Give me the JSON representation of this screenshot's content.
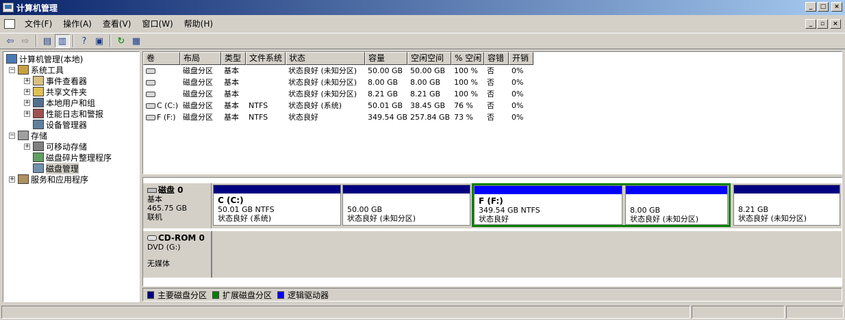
{
  "window": {
    "title": "计算机管理",
    "buttons": [
      "_",
      "□",
      "×"
    ]
  },
  "menubar": {
    "items": [
      "文件(F)",
      "操作(A)",
      "查看(V)",
      "窗口(W)",
      "帮助(H)"
    ],
    "mdi_buttons": [
      "_",
      "▫",
      "×"
    ]
  },
  "toolbar": {
    "icons": [
      "back-arrow-icon",
      "forward-arrow-icon",
      "up-folder-icon",
      "show-tree-icon",
      "help-icon",
      "console-icon",
      "refresh-icon",
      "properties-icon"
    ]
  },
  "tree": {
    "items": [
      {
        "label": "计算机管理(本地)",
        "level": 0,
        "expander": "",
        "icon": "computer-icon"
      },
      {
        "label": "系统工具",
        "level": 1,
        "expander": "−",
        "icon": "tools-icon"
      },
      {
        "label": "事件查看器",
        "level": 2,
        "expander": "+",
        "icon": "event-viewer-icon"
      },
      {
        "label": "共享文件夹",
        "level": 2,
        "expander": "+",
        "icon": "shared-folder-icon"
      },
      {
        "label": "本地用户和组",
        "level": 2,
        "expander": "+",
        "icon": "users-icon"
      },
      {
        "label": "性能日志和警报",
        "level": 2,
        "expander": "+",
        "icon": "performance-icon"
      },
      {
        "label": "设备管理器",
        "level": 2,
        "expander": "",
        "icon": "device-manager-icon"
      },
      {
        "label": "存储",
        "level": 1,
        "expander": "−",
        "icon": "storage-icon"
      },
      {
        "label": "可移动存储",
        "level": 2,
        "expander": "+",
        "icon": "removable-storage-icon"
      },
      {
        "label": "磁盘碎片整理程序",
        "level": 2,
        "expander": "",
        "icon": "defrag-icon"
      },
      {
        "label": "磁盘管理",
        "level": 2,
        "expander": "",
        "icon": "disk-management-icon",
        "selected": true
      },
      {
        "label": "服务和应用程序",
        "level": 1,
        "expander": "+",
        "icon": "services-icon"
      }
    ]
  },
  "volume_list": {
    "columns": [
      "卷",
      "布局",
      "类型",
      "文件系统",
      "状态",
      "容量",
      "空闲空间",
      "% 空闲",
      "容错",
      "开销"
    ],
    "rows": [
      [
        "",
        "磁盘分区",
        "基本",
        "",
        "状态良好 (未知分区)",
        "50.00 GB",
        "50.00 GB",
        "100 %",
        "否",
        "0%"
      ],
      [
        "",
        "磁盘分区",
        "基本",
        "",
        "状态良好 (未知分区)",
        "8.00 GB",
        "8.00 GB",
        "100 %",
        "否",
        "0%"
      ],
      [
        "",
        "磁盘分区",
        "基本",
        "",
        "状态良好 (未知分区)",
        "8.21 GB",
        "8.21 GB",
        "100 %",
        "否",
        "0%"
      ],
      [
        "C (C:)",
        "磁盘分区",
        "基本",
        "NTFS",
        "状态良好 (系统)",
        "50.01 GB",
        "38.45 GB",
        "76 %",
        "否",
        "0%"
      ],
      [
        "F (F:)",
        "磁盘分区",
        "基本",
        "NTFS",
        "状态良好",
        "349.54 GB",
        "257.84 GB",
        "73 %",
        "否",
        "0%"
      ]
    ]
  },
  "disk0": {
    "name": "磁盘 0",
    "type": "基本",
    "size": "465.75 GB",
    "status": "联机",
    "partitions": [
      {
        "name": "C  (C:)",
        "size": "50.01 GB NTFS",
        "status": "状态良好 (系统)",
        "kind": "primary"
      },
      {
        "name": "",
        "size": "50.00 GB",
        "status": "状态良好 (未知分区)",
        "kind": "primary"
      },
      {
        "name": "F  (F:)",
        "size": "349.54 GB NTFS",
        "status": "状态良好",
        "kind": "logical"
      },
      {
        "name": "",
        "size": "8.00 GB",
        "status": "状态良好 (未知分区)",
        "kind": "logical"
      },
      {
        "name": "",
        "size": "8.21 GB",
        "status": "状态良好 (未知分区)",
        "kind": "primary"
      }
    ]
  },
  "cdrom0": {
    "name": "CD-ROM 0",
    "drive": "DVD (G:)",
    "media": "无媒体"
  },
  "legend": {
    "items": [
      {
        "label": "主要磁盘分区",
        "color": "#000080"
      },
      {
        "label": "扩展磁盘分区",
        "color": "#008000"
      },
      {
        "label": "逻辑驱动器",
        "color": "#0000ff"
      }
    ]
  }
}
